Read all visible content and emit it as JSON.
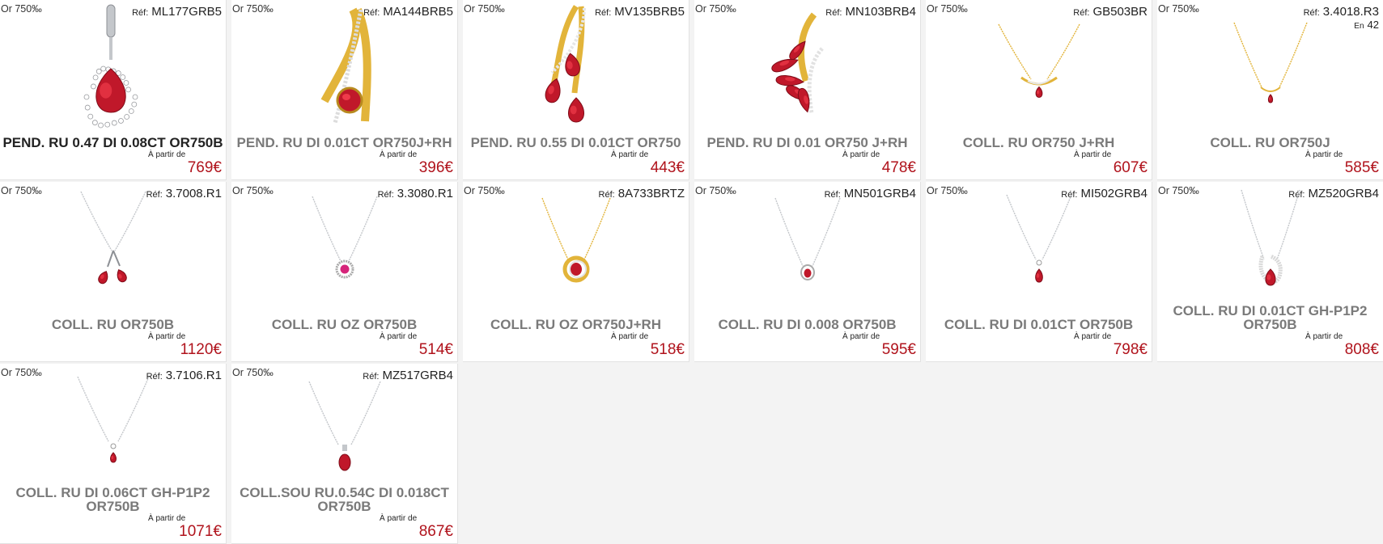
{
  "from_label": "À partir de",
  "ref_label": "Réf:",
  "stock_label": "En",
  "colors": {
    "price": "#b0131c",
    "gold": "#e2b43a",
    "silver": "#bfc2c6",
    "ruby": "#c0182a"
  },
  "products": [
    {
      "metal": "Or 750‰",
      "ref": "ML177GRB5",
      "name": "PEND. RU 0.47 DI 0.08CT OR750B",
      "price": "769€",
      "icon": "pendant-teardrop-halo-icon"
    },
    {
      "metal": "Or 750‰",
      "ref": "MA144BRB5",
      "name": "PEND. RU DI 0.01CT OR750J+RH",
      "price": "396€",
      "icon": "pendant-gold-swirl-icon"
    },
    {
      "metal": "Or 750‰",
      "ref": "MV135BRB5",
      "name": "PEND. RU 0.55 DI 0.01CT OR750",
      "price": "443€",
      "icon": "pendant-three-drops-icon"
    },
    {
      "metal": "Or 750‰",
      "ref": "MN103BRB4",
      "name": "PEND. RU DI 0.01 OR750 J+RH",
      "price": "478€",
      "icon": "pendant-leaf-rubies-icon"
    },
    {
      "metal": "Or 750‰",
      "ref": "GB503BR",
      "name": "COLL. RU OR750 J+RH",
      "price": "607€",
      "icon": "necklace-gold-v-icon"
    },
    {
      "metal": "Or 750‰",
      "ref": "3.4018.R3",
      "stock": "42",
      "name": "COLL. RU OR750J",
      "price": "585€",
      "icon": "necklace-gold-thin-icon"
    },
    {
      "metal": "Or 750‰",
      "ref": "3.7008.R1",
      "name": "COLL. RU OR750B",
      "price": "1120€",
      "icon": "necklace-twin-drops-icon"
    },
    {
      "metal": "Or 750‰",
      "ref": "3.3080.R1",
      "name": "COLL. RU OZ OR750B",
      "price": "514€",
      "icon": "necklace-round-halo-icon"
    },
    {
      "metal": "Or 750‰",
      "ref": "8A733BRTZ",
      "name": "COLL. RU OZ OR750J+RH",
      "price": "518€",
      "icon": "necklace-gold-circle-icon"
    },
    {
      "metal": "Or 750‰",
      "ref": "MN501GRB4",
      "name": "COLL. RU DI 0.008 OR750B",
      "price": "595€",
      "icon": "necklace-small-drop-icon"
    },
    {
      "metal": "Or 750‰",
      "ref": "MI502GRB4",
      "name": "COLL. RU DI 0.01CT OR750B",
      "price": "798€",
      "icon": "necklace-pear-drop-icon"
    },
    {
      "metal": "Or 750‰",
      "ref": "MZ520GRB4",
      "name": "COLL. RU DI 0.01CT GH-P1P2 OR750B",
      "price": "808€",
      "icon": "necklace-pave-swirl-icon"
    },
    {
      "metal": "Or 750‰",
      "ref": "3.7106.R1",
      "name": "COLL. RU DI 0.06CT GH-P1P2 OR750B",
      "price": "1071€",
      "icon": "necklace-tiny-drop-icon"
    },
    {
      "metal": "Or 750‰",
      "ref": "MZ517GRB4",
      "name": "COLL.SOU RU.0.54C DI 0.018CT OR750B",
      "price": "867€",
      "icon": "necklace-oval-ruby-icon"
    }
  ]
}
